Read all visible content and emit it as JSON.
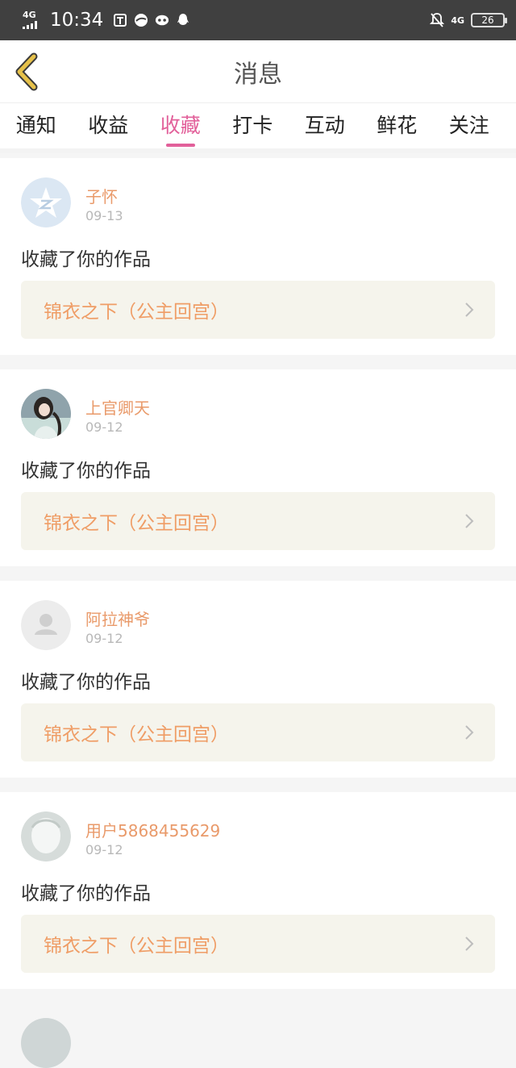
{
  "status_bar": {
    "network": "4G",
    "time": "10:34",
    "right_network": "4G",
    "battery": "26"
  },
  "header": {
    "title": "消息"
  },
  "tabs": [
    {
      "label": "通知",
      "active": false
    },
    {
      "label": "收益",
      "active": false
    },
    {
      "label": "收藏",
      "active": true
    },
    {
      "label": "打卡",
      "active": false
    },
    {
      "label": "互动",
      "active": false
    },
    {
      "label": "鲜花",
      "active": false
    },
    {
      "label": "关注",
      "active": false
    }
  ],
  "feed": [
    {
      "name": "子怀",
      "date": "09-13",
      "action": "收藏了你的作品",
      "work": "锦衣之下（公主回宫）",
      "avatar": "qzone-star-avatar"
    },
    {
      "name": "上官卿天",
      "date": "09-12",
      "action": "收藏了你的作品",
      "work": "锦衣之下（公主回宫）",
      "avatar": "photo-avatar"
    },
    {
      "name": "阿拉神爷",
      "date": "09-12",
      "action": "收藏了你的作品",
      "work": "锦衣之下（公主回宫）",
      "avatar": "default-person-avatar"
    },
    {
      "name": "用户5868455629",
      "date": "09-12",
      "action": "收藏了你的作品",
      "work": "锦衣之下（公主回宫）",
      "avatar": "default-gray-avatar"
    }
  ],
  "colors": {
    "accent": "#e2609a",
    "username": "#e99a6a",
    "work_title": "#ef9d66",
    "work_box": "#f5f4ec",
    "back_arrow": "#e6c14a"
  }
}
